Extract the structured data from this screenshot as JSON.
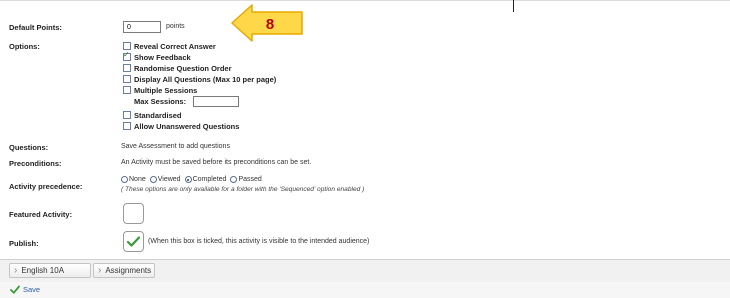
{
  "fields": {
    "default_points_label": "Default Points:",
    "default_points_value": "0",
    "points_unit": "points",
    "options_label": "Options:",
    "options": [
      {
        "label": "Reveal Correct Answer",
        "checked": false
      },
      {
        "label": "Show Feedback",
        "checked": true
      },
      {
        "label": "Randomise Question Order",
        "checked": false
      },
      {
        "label": "Display All Questions (Max 10 per page)",
        "checked": false
      },
      {
        "label": "Multiple Sessions",
        "checked": false
      }
    ],
    "max_sessions_label": "Max Sessions:",
    "max_sessions_value": "",
    "options_after": [
      {
        "label": "Standardised",
        "checked": false
      },
      {
        "label": "Allow Unanswered Questions",
        "checked": false
      }
    ],
    "questions_label": "Questions:",
    "questions_text": "Save Assessment to add questions",
    "preconditions_label": "Preconditions:",
    "preconditions_text": "An Activity must be saved before its preconditions can be set.",
    "activity_precedence_label": "Activity precedence:",
    "precedence_options": [
      "None",
      "Viewed",
      "Completed",
      "Passed"
    ],
    "precedence_selected": "Completed",
    "precedence_note": "( These options are only available for a folder with the 'Sequenced' option enabled )",
    "featured_label": "Featured Activity:",
    "featured_checked": false,
    "publish_label": "Publish:",
    "publish_checked": true,
    "publish_text": "(When this box is ticked, this activity is visible to the intended audience)"
  },
  "breadcrumb": [
    "English 10A",
    "Assignments"
  ],
  "save_label": "Save",
  "callout_number": "8",
  "colors": {
    "callout_fill": "#ffd84a",
    "callout_border": "#e8a800",
    "callout_text": "#b30000",
    "save_text": "#2b5fa3",
    "check": "#3a9a3a"
  }
}
